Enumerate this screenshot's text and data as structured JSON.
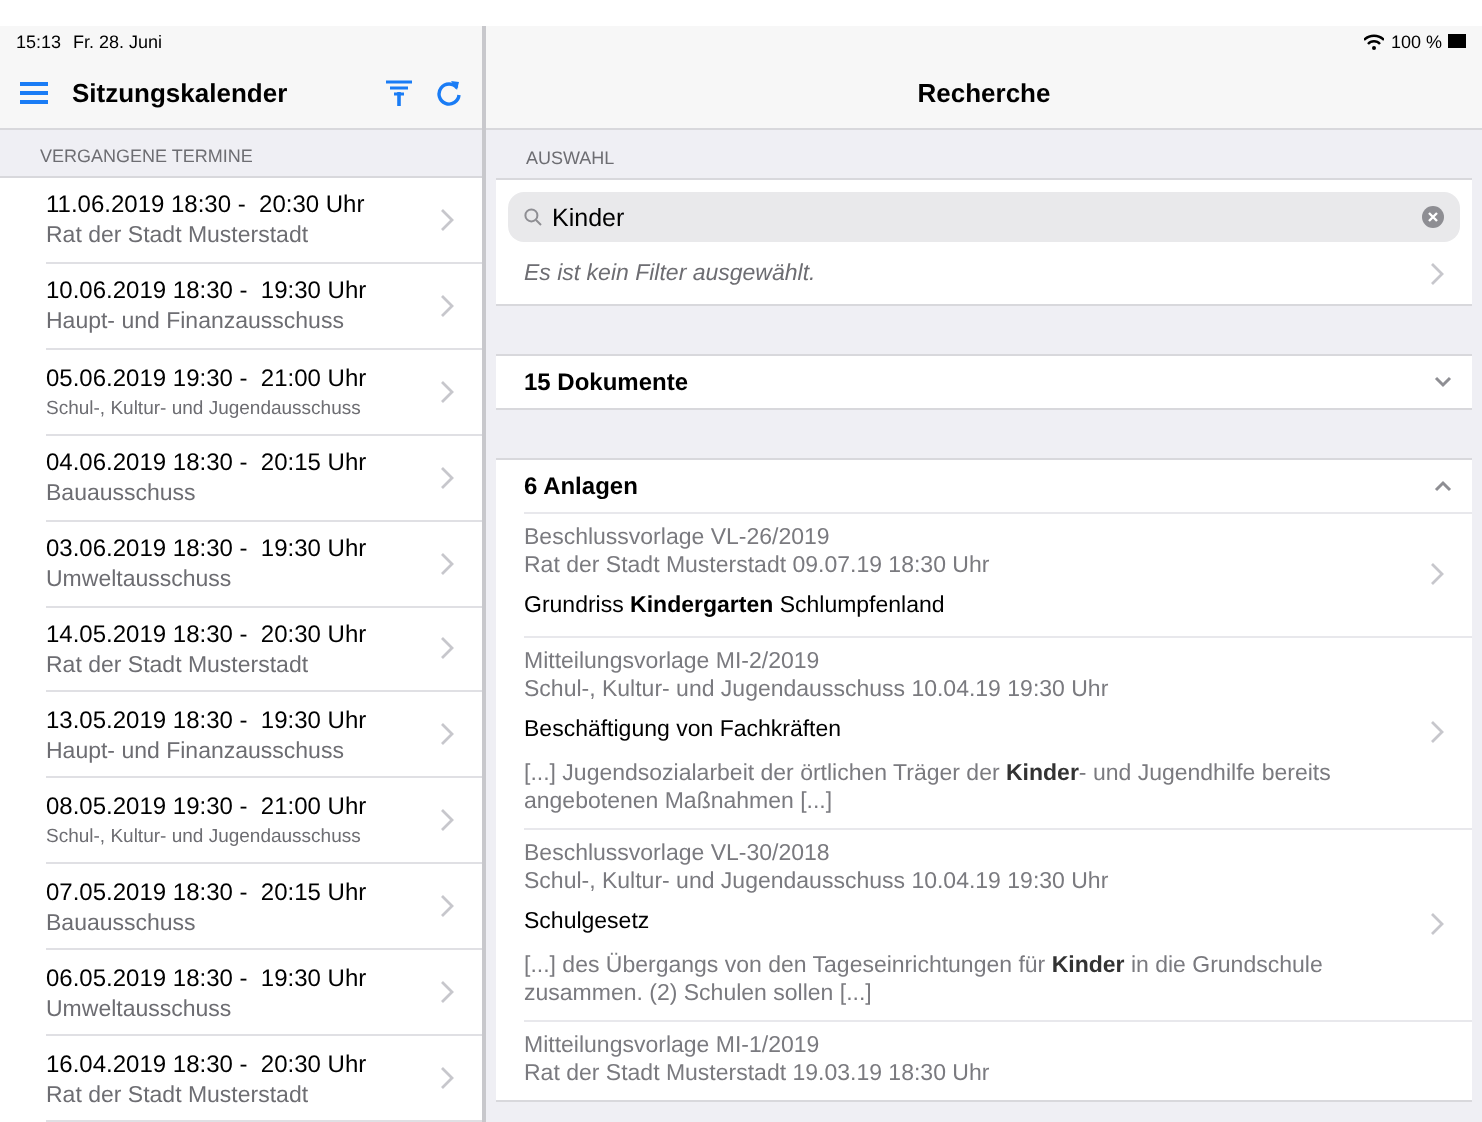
{
  "status_bar": {
    "time": "15:13",
    "date": "Fr. 28. Juni",
    "battery": "100 %"
  },
  "sidebar": {
    "title": "Sitzungskalender",
    "section": "VERGANGENE TERMINE",
    "items": [
      {
        "time": "11.06.2019 18:30 -  20:30 Uhr",
        "committee": "Rat der Stadt Musterstadt",
        "compact": false
      },
      {
        "time": "10.06.2019 18:30 -  19:30 Uhr",
        "committee": "Haupt- und Finanzausschuss",
        "compact": false
      },
      {
        "time": "05.06.2019 19:30 -  21:00 Uhr",
        "committee": "Schul-, Kultur- und Jugendausschuss",
        "compact": true
      },
      {
        "time": "04.06.2019 18:30 -  20:15 Uhr",
        "committee": "Bauausschuss",
        "compact": false
      },
      {
        "time": "03.06.2019 18:30 -  19:30 Uhr",
        "committee": "Umweltausschuss",
        "compact": false
      },
      {
        "time": "14.05.2019 18:30 -  20:30 Uhr",
        "committee": "Rat der Stadt Musterstadt",
        "compact": false
      },
      {
        "time": "13.05.2019 18:30 -  19:30 Uhr",
        "committee": "Haupt- und Finanzausschuss",
        "compact": false
      },
      {
        "time": "08.05.2019 19:30 -  21:00 Uhr",
        "committee": "Schul-, Kultur- und Jugendausschuss",
        "compact": true
      },
      {
        "time": "07.05.2019 18:30 -  20:15 Uhr",
        "committee": "Bauausschuss",
        "compact": false
      },
      {
        "time": "06.05.2019 18:30 -  19:30 Uhr",
        "committee": "Umweltausschuss",
        "compact": false
      },
      {
        "time": "16.04.2019 18:30 -  20:30 Uhr",
        "committee": "Rat der Stadt Musterstadt",
        "compact": false
      }
    ]
  },
  "main": {
    "title": "Recherche",
    "section": "AUSWAHL",
    "search": {
      "value": "Kinder"
    },
    "filter": "Es ist kein Filter ausgewählt.",
    "groups": [
      {
        "label": "15 Dokumente",
        "expanded": false
      },
      {
        "label": "6 Anlagen",
        "expanded": true,
        "results": [
          {
            "type": "Beschlussvorlage VL-26/2019",
            "meeting": "Rat der Stadt Musterstadt 09.07.19 18:30 Uhr",
            "title": "Grundriss **Kindergarten** Schlumpfenland"
          },
          {
            "type": "Mitteilungsvorlage MI-2/2019",
            "meeting": "Schul-, Kultur- und Jugendausschuss 10.04.19 19:30 Uhr",
            "title": "Beschäftigung von Fachkräften",
            "excerpt": "[...] Jugendsozialarbeit der örtlichen Träger der **Kinder**- und Jugendhilfe bereits angebotenen Maßnahmen [...]"
          },
          {
            "type": "Beschlussvorlage VL-30/2018",
            "meeting": "Schul-, Kultur- und Jugendausschuss 10.04.19 19:30 Uhr",
            "title": "Schulgesetz",
            "excerpt": "[...] des Übergangs von den Tageseinrichtungen für **Kinder** in die Grundschule zusammen. (2) Schulen sollen [...]"
          },
          {
            "type": "Mitteilungsvorlage MI-1/2019",
            "meeting": "Rat der Stadt Musterstadt 19.03.19 18:30 Uhr"
          }
        ]
      }
    ]
  }
}
